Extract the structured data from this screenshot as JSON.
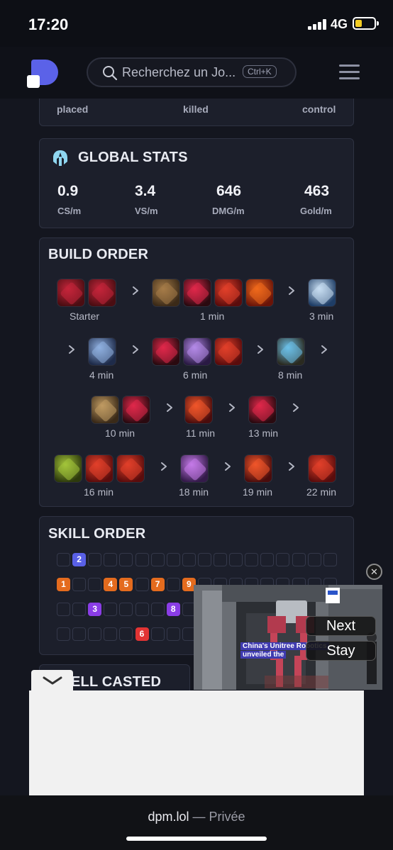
{
  "status": {
    "time": "17:20",
    "network": "4G"
  },
  "header": {
    "search_placeholder": "Recherchez un Jo...",
    "shortcut": "Ctrl+K"
  },
  "top_card": {
    "labels": [
      "placed",
      "killed",
      "control"
    ]
  },
  "global_stats": {
    "title": "GLOBAL STATS",
    "stats": [
      {
        "value": "0.9",
        "label": "CS/m"
      },
      {
        "value": "3.4",
        "label": "VS/m"
      },
      {
        "value": "646",
        "label": "DMG/m"
      },
      {
        "value": "463",
        "label": "Gold/m"
      }
    ]
  },
  "build_order": {
    "title": "BUILD ORDER",
    "groups": [
      {
        "time": "Starter",
        "items": [
          "red-potion",
          "red-potion"
        ]
      },
      {
        "time": "1 min",
        "items": [
          "boots",
          "ruby-crystal",
          "red-orb",
          "red-tome"
        ]
      },
      {
        "time": "3 min",
        "items": [
          "blue-wolf"
        ]
      },
      {
        "time": "4 min",
        "items": [
          "blue-armor"
        ]
      },
      {
        "time": "6 min",
        "items": [
          "ruby-crystal",
          "purple-orb",
          "red-orb"
        ]
      },
      {
        "time": "8 min",
        "items": [
          "blue-vest"
        ]
      },
      {
        "time": "10 min",
        "items": [
          "golem",
          "ruby-crystal"
        ]
      },
      {
        "time": "11 min",
        "items": [
          "red-flask"
        ]
      },
      {
        "time": "13 min",
        "items": [
          "ruby-crystal"
        ]
      },
      {
        "time": "16 min",
        "items": [
          "green-cannon",
          "red-orb",
          "red-orb"
        ]
      },
      {
        "time": "18 min",
        "items": [
          "purple-book"
        ]
      },
      {
        "time": "19 min",
        "items": [
          "red-flask"
        ]
      },
      {
        "time": "22 min",
        "items": [
          "red-orb"
        ]
      }
    ]
  },
  "skill_order": {
    "title": "SKILL ORDER",
    "levels": [
      {
        "level": "1",
        "row": 1,
        "col": 0
      },
      {
        "level": "2",
        "row": 0,
        "col": 1
      },
      {
        "level": "3",
        "row": 2,
        "col": 2
      },
      {
        "level": "4",
        "row": 1,
        "col": 3
      },
      {
        "level": "5",
        "row": 1,
        "col": 4
      },
      {
        "level": "6",
        "row": 3,
        "col": 5
      },
      {
        "level": "7",
        "row": 1,
        "col": 6
      },
      {
        "level": "8",
        "row": 2,
        "col": 7
      },
      {
        "level": "9",
        "row": 1,
        "col": 8
      }
    ]
  },
  "next_section": {
    "title_partial": "ELL CASTED"
  },
  "video_ad": {
    "next_label": "Next",
    "stay_label": "Stay",
    "caption_line1": "China's Unitree Robotics",
    "caption_line2": "unveiled the",
    "badge": "euro news."
  },
  "browser": {
    "domain": "dpm.lol",
    "separator": " — ",
    "mode": "Privée"
  },
  "colors": {
    "accent": "#5b62e8",
    "skill_q": "#e46b1e",
    "skill_w": "#5960e6",
    "skill_e": "#8a3de6",
    "skill_r": "#e23434"
  }
}
